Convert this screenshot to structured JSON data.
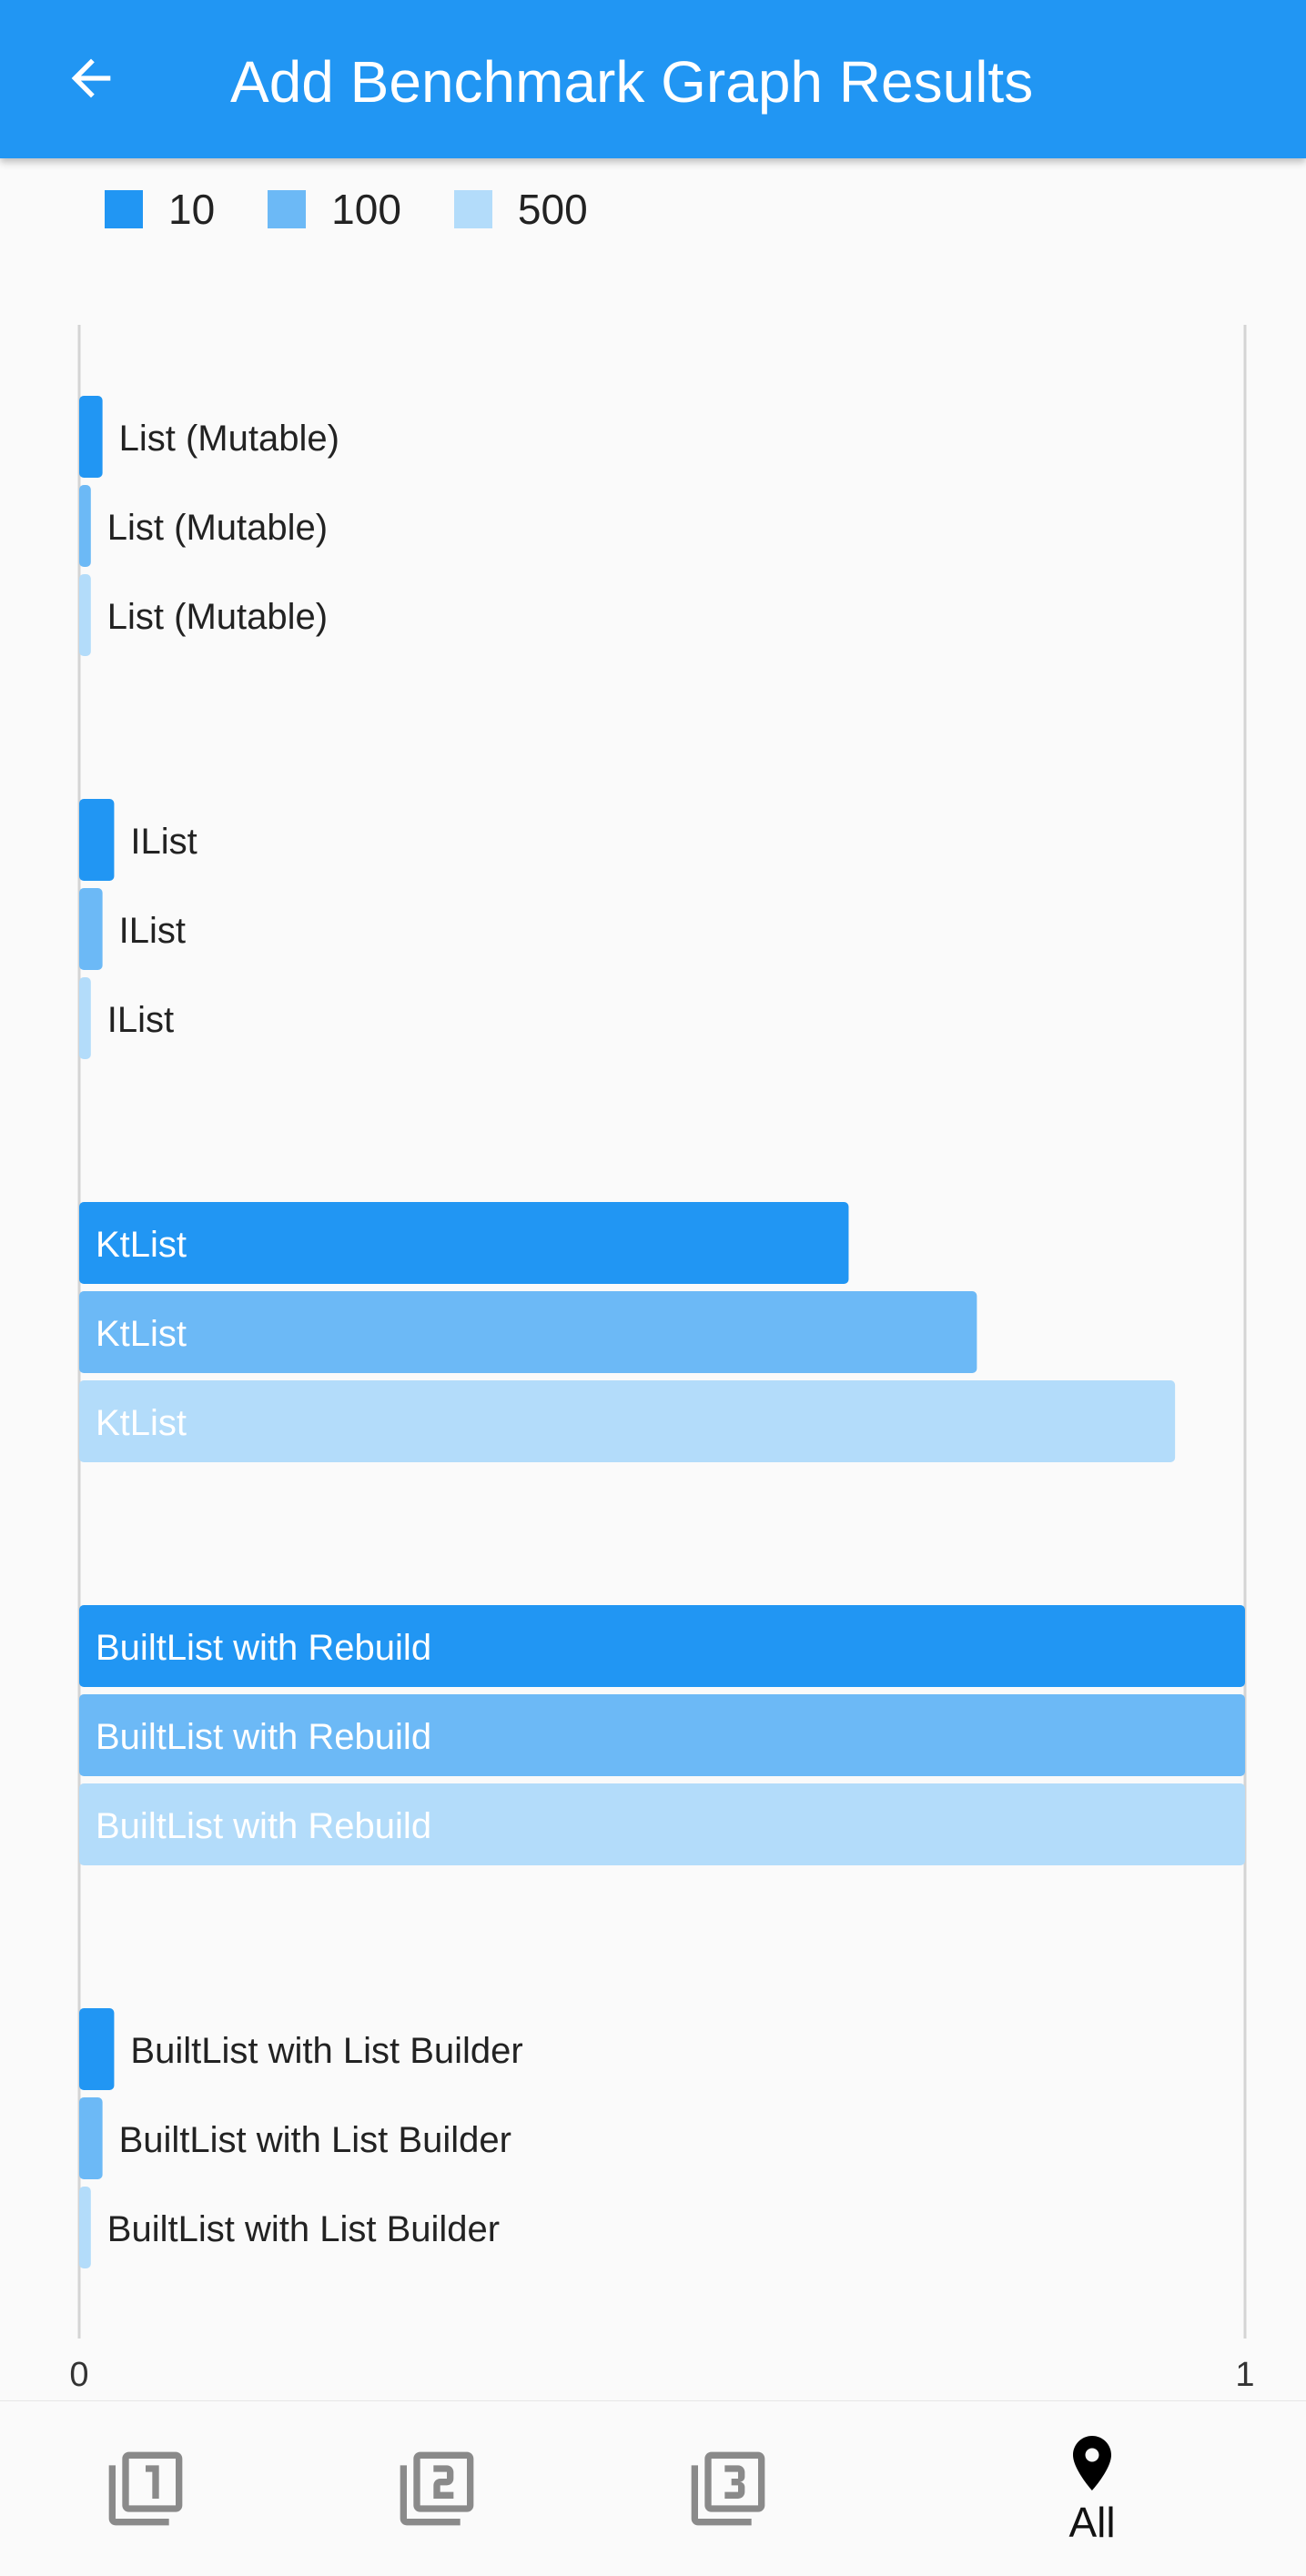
{
  "app_bar": {
    "title": "Add Benchmark Graph Results",
    "back_icon": "arrow-left-icon"
  },
  "colors": {
    "primary": "#2196f3",
    "series_10": "#2196f3",
    "series_100": "#6cb9f6",
    "series_500": "#b3dcfa",
    "axis": "#d4d4d4"
  },
  "legend": [
    {
      "label": "10",
      "color": "#2196f3"
    },
    {
      "label": "100",
      "color": "#6cb9f6"
    },
    {
      "label": "500",
      "color": "#b3dcfa"
    }
  ],
  "chart_data": {
    "type": "bar",
    "orientation": "horizontal",
    "categories": [
      "List (Mutable)",
      "IList",
      "KtList",
      "BuiltList with Rebuild",
      "BuiltList with List Builder"
    ],
    "series": [
      {
        "name": "10",
        "values": [
          0.02,
          0.03,
          0.66,
          1.0,
          0.03
        ]
      },
      {
        "name": "100",
        "values": [
          0.01,
          0.02,
          0.77,
          1.0,
          0.02
        ]
      },
      {
        "name": "500",
        "values": [
          0.01,
          0.01,
          0.94,
          1.0,
          0.01
        ]
      }
    ],
    "xlim": [
      0,
      1
    ],
    "x_ticks": [
      "0",
      "1"
    ],
    "legend_position": "top-left",
    "grid": false
  },
  "bottom_nav": [
    {
      "icon": "filter-1-icon",
      "label": ""
    },
    {
      "icon": "filter-2-icon",
      "label": ""
    },
    {
      "icon": "filter-3-icon",
      "label": ""
    },
    {
      "icon": "location-pin-icon",
      "label": "All"
    }
  ]
}
